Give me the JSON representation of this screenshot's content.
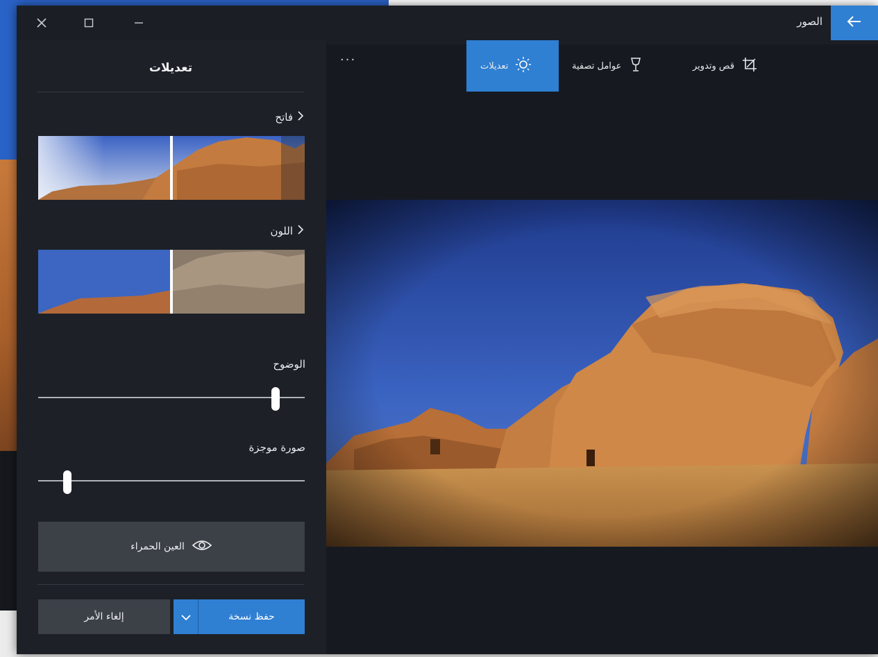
{
  "app": {
    "title": "الصور",
    "back_icon": "arrow-left-icon",
    "window_controls": [
      "close-icon",
      "maximize-icon",
      "minimize-icon"
    ]
  },
  "toolbar": {
    "crop_label": "قص وتدوير",
    "filters_label": "عوامل تصفية",
    "adjust_label": "تعديلات",
    "more_label": "···"
  },
  "panel": {
    "title": "تعديلات",
    "light": {
      "label": "فاتح"
    },
    "color": {
      "label": "اللون"
    },
    "clarity": {
      "label": "الوضوح",
      "value": 0.89
    },
    "vignette": {
      "label": "صورة موجزة",
      "value": 0.11
    },
    "red_eye_label": "العين الحمراء",
    "save_copy_label": "حفظ نسخة",
    "cancel_label": "إلغاء الأمر"
  },
  "colors": {
    "accent": "#2f7fd3",
    "panel_bg": "#1d2127",
    "canvas_bg": "#161a20",
    "button_bg": "#3c4047"
  }
}
